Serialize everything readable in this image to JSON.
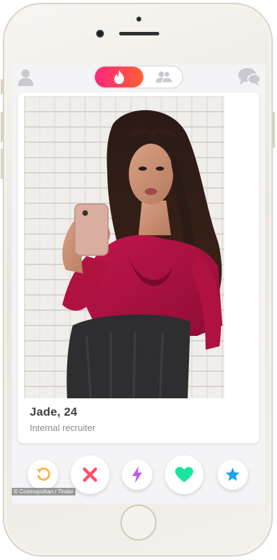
{
  "profile": {
    "name_age": "Jade, 24",
    "occupation": "Internal recruiter"
  },
  "watermark": "© Cosmopolitan / Tinder",
  "colors": {
    "accent_gradient_start": "#fd267a",
    "accent_gradient_end": "#ff6036",
    "rewind": "#f5b748",
    "nope": "#fd5068",
    "boost": "#b95bf5",
    "like": "#1be4a1",
    "super_like": "#1ea1f1",
    "inactive_icon": "#c9c9cf"
  },
  "icons": {
    "profile": "profile-icon",
    "discover": "flame-icon",
    "social": "group-icon",
    "messages": "chat-bubbles-icon",
    "rewind": "rewind-icon",
    "nope": "x-icon",
    "boost": "lightning-icon",
    "like": "heart-icon",
    "super_like": "star-icon"
  }
}
